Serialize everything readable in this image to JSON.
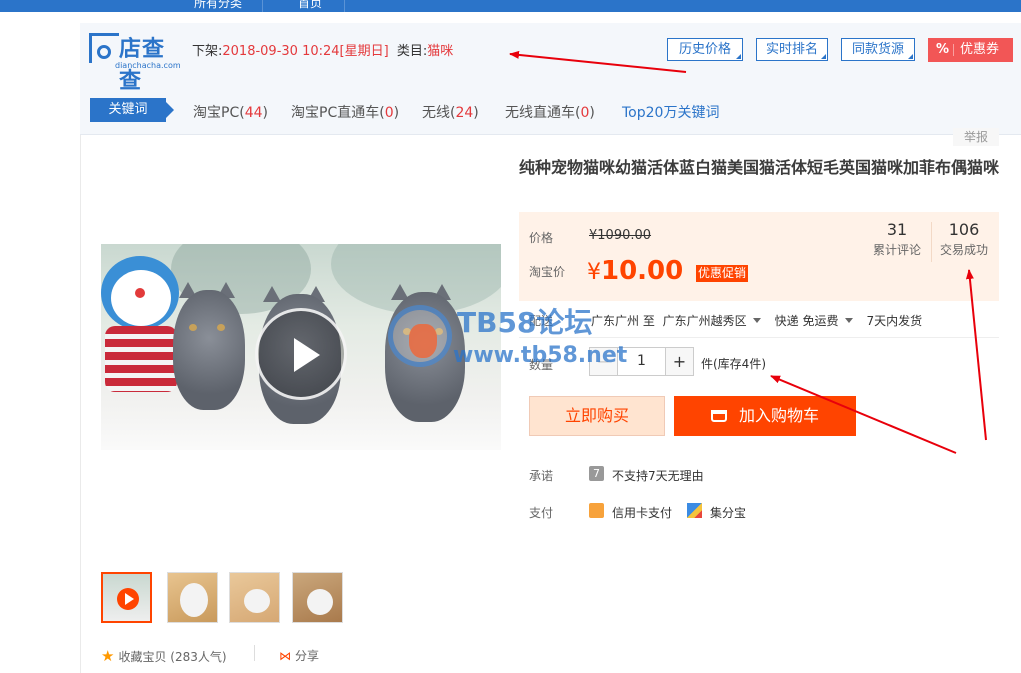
{
  "top_nav": {
    "items": [
      "所有分类",
      "首页"
    ]
  },
  "plugin": {
    "logo_name": "店查查",
    "logo_url": "dianchacha.com",
    "listing_label": "下架:",
    "listing_time": "2018-09-30 10:24[星期日]",
    "category_label": "类目:",
    "category_value": "猫咪",
    "buttons": [
      "历史价格",
      "实时排名",
      "同款货源"
    ],
    "coupon_symbol": "%",
    "coupon_label": "优惠券",
    "keyword_tab": "关键词",
    "keyword_links": [
      {
        "label": "淘宝PC",
        "count": "44"
      },
      {
        "label": "淘宝PC直通车",
        "count": "0"
      },
      {
        "label": "无线",
        "count": "24"
      },
      {
        "label": "无线直通车",
        "count": "0"
      }
    ],
    "top20_label": "Top20万关键词"
  },
  "product": {
    "report_label": "举报",
    "title": "纯种宠物猫咪幼猫活体蓝白猫美国猫活体短毛英国猫咪加菲布偶猫咪",
    "price_label": "价格",
    "original_price": "¥1090.00",
    "taobao_price_label": "淘宝价",
    "current_price_symbol": "¥",
    "current_price_value": "10.00",
    "promo_label": "优惠促销",
    "reviews": {
      "value": "31",
      "label": "累计评论"
    },
    "transactions": {
      "value": "106",
      "label": "交易成功"
    },
    "delivery_label": "配送",
    "delivery_from": "广东广州 至",
    "delivery_to": "广东广州越秀区",
    "delivery_method": "快递 免运费",
    "delivery_time": "7天内发货",
    "quantity_label": "数量",
    "quantity_value": "1",
    "quantity_minus": "−",
    "quantity_plus": "+",
    "stock_text": "件(库存4件)",
    "buy_now_label": "立即购买",
    "add_cart_label": "加入购物车",
    "promise_label": "承诺",
    "promise_text": "不支持7天无理由",
    "payment_label": "支付",
    "payment_methods": [
      "信用卡支付",
      "集分宝"
    ],
    "favorite_label": "收藏宝贝",
    "favorite_count": "(283人气)",
    "share_label": "分享"
  },
  "watermark": {
    "title": "TB58论坛",
    "url": "www.tb58.net"
  },
  "colors": {
    "brand_blue": "#2b74c9",
    "taobao_orange": "#ff4400",
    "price_bg": "#fff2e8",
    "coupon_red": "#f25656",
    "annotation_red": "#e8000b"
  }
}
